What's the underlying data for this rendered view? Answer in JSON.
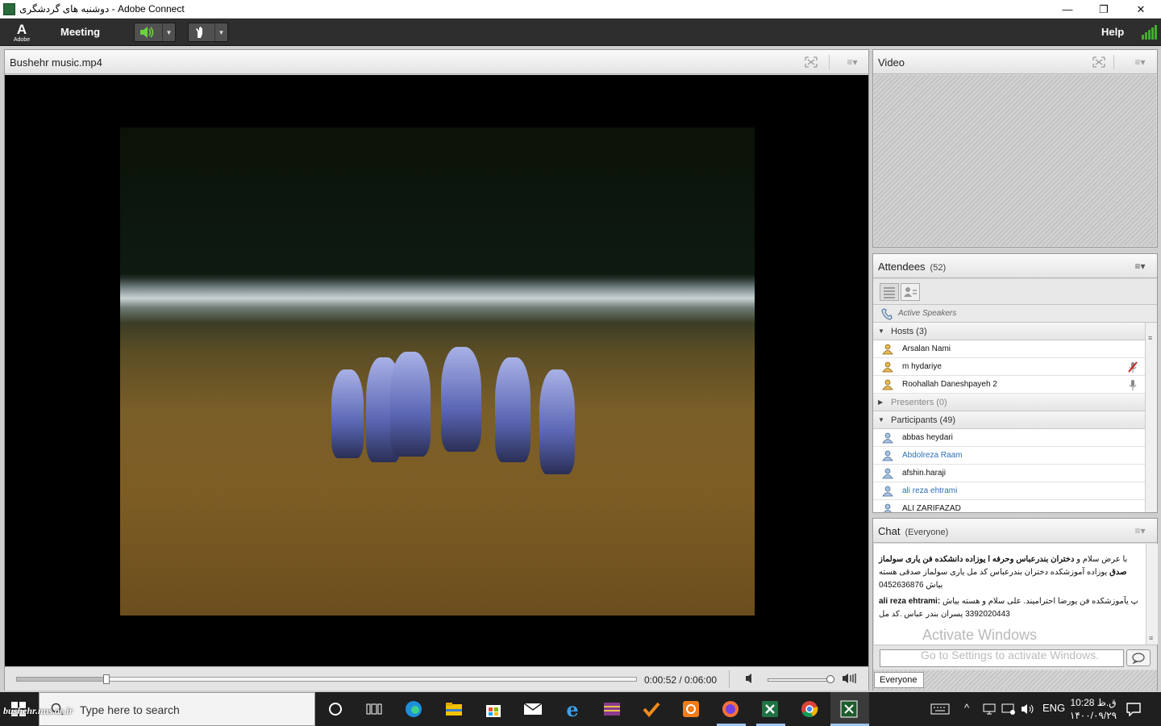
{
  "window": {
    "title": "دوشنبه های گردشگری - Adobe Connect",
    "controls": {
      "minimize": "—",
      "restore": "❐",
      "close": "✕"
    }
  },
  "menubar": {
    "logo_text": "Adobe",
    "meeting_label": "Meeting",
    "help_label": "Help",
    "accent_color": "#3fae2a"
  },
  "share_pod": {
    "title": "Bushehr music.mp4",
    "time_display": "0:00:52 / 0:06:00",
    "elapsed": "0:00:52",
    "duration": "0:06:00",
    "progress_fraction": 0.144,
    "volume_fraction": 0.96
  },
  "video_pod": {
    "title": "Video"
  },
  "attendees_pod": {
    "title": "Attendees",
    "count": "(52)",
    "active_speakers_label": "Active Speakers",
    "hosts": {
      "label": "Hosts (3)",
      "items": [
        {
          "name": "Arsalan  Nami",
          "blue": false,
          "status": ""
        },
        {
          "name": "m hydariye",
          "blue": false,
          "status": "mic-muted-icon"
        },
        {
          "name": "Roohallah Daneshpayeh 2",
          "blue": false,
          "status": "mic-icon"
        }
      ]
    },
    "presenters": {
      "label": "Presenters (0)"
    },
    "participants": {
      "label": "Participants (49)",
      "items": [
        {
          "name": "abbas heydari",
          "blue": false
        },
        {
          "name": "Abdolreza Raam",
          "blue": true
        },
        {
          "name": "afshin.haraji",
          "blue": false
        },
        {
          "name": "ali reza ehtrami",
          "blue": true
        },
        {
          "name": "ALI ZARIFAZAD",
          "blue": false
        }
      ]
    }
  },
  "chat_pod": {
    "title": "Chat",
    "scope": "(Everyone)",
    "messages": [
      {
        "sender": "دختران بندرعباس وحرفه ا یوزاده  دانشکده فن یاری سولماز صدق",
        "prefix": "با عرض سلام و ",
        "text": "یوزاده آموزشکده دختران بندرعباس کد مل یاری سولماز صدقی هسته بیاش 0452636876"
      },
      {
        "sender": "ali reza ehtrami:",
        "prefix": "",
        "text": "پ یآموزشکده فن یورضا احترامیند. علی سلام و هسته بیاش 3392020443 یسران بندر عباس .کد مل"
      }
    ],
    "watermark_title": "Activate Windows",
    "watermark_sub": "Go to Settings to activate Windows.",
    "recipient_tab": "Everyone"
  },
  "taskbar": {
    "search_placeholder": "Type here to search",
    "watermark_text": "bushehr.nus.ac.ir",
    "language": "ENG",
    "time": "10:28 ق.ظ",
    "date": "۱۴۰۰/۰۹/۲۹"
  }
}
